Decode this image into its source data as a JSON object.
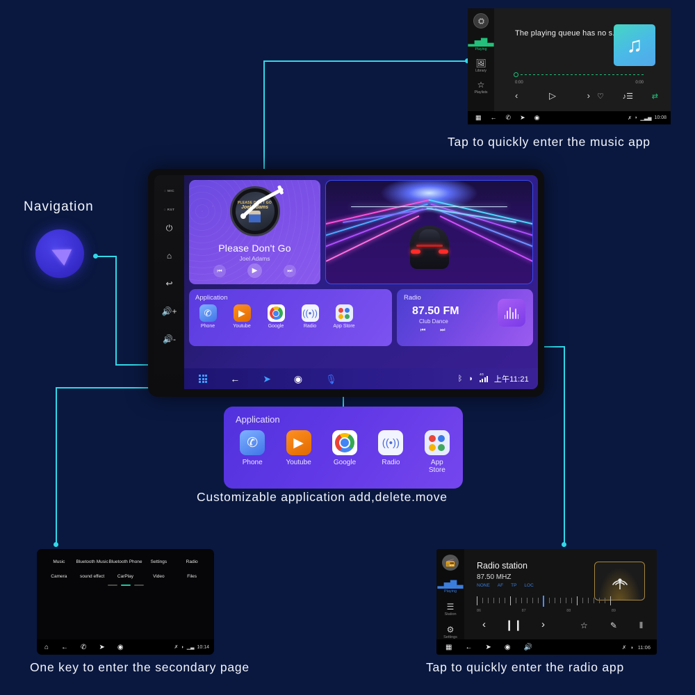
{
  "page": {
    "background_color": "#0a1840",
    "accent_line_color": "#31d9e8"
  },
  "navigation_badge": {
    "label": "Navigation",
    "icon": "navigation-arrow-icon"
  },
  "captions": {
    "music": "Tap to quickly enter the music app",
    "application": "Customizable application add,delete.move",
    "secondary": "One key to enter the secondary page",
    "radio": "Tap to quickly enter the radio app"
  },
  "music_app": {
    "sidebar": {
      "chip_icon": "app-chip-icon",
      "items": [
        {
          "label": "Playing",
          "icon": "equalizer-icon",
          "active": true
        },
        {
          "label": "Library",
          "icon": "library-image-icon",
          "active": false
        },
        {
          "label": "Playlists",
          "icon": "star-icon",
          "active": false
        }
      ]
    },
    "now_playing_text": "The playing queue has no s...",
    "album_art_icon": "music-note-icon",
    "time_elapsed": "0:00",
    "time_total": "0:00",
    "controls": [
      {
        "name": "previous-button",
        "glyph": "‹"
      },
      {
        "name": "play-button",
        "glyph": "▷"
      },
      {
        "name": "next-button",
        "glyph": "›"
      }
    ],
    "secondary_controls": [
      {
        "name": "favorite-button",
        "glyph": "♡",
        "active": false
      },
      {
        "name": "queue-button",
        "glyph": "♪☰",
        "active": false
      },
      {
        "name": "repeat-button",
        "glyph": "⇄",
        "active": true
      }
    ],
    "taskbar": {
      "left_icons": [
        "apps-grid-icon",
        "back-arrow-icon",
        "phone-icon",
        "navigation-icon",
        "play-circle-icon"
      ],
      "status_icons": [
        "bluetooth-off-icon",
        "wifi-icon",
        "signal-icon"
      ],
      "time": "10:08"
    }
  },
  "head_unit": {
    "side_buttons": [
      {
        "label": "MIC",
        "type": "text"
      },
      {
        "label": "RST",
        "type": "text"
      },
      {
        "label": "power-icon",
        "glyph": "⏻"
      },
      {
        "label": "home-icon",
        "glyph": "⌂"
      },
      {
        "label": "back-icon",
        "glyph": "↩"
      },
      {
        "label": "volume-up-icon",
        "glyph": "◁+"
      },
      {
        "label": "volume-down-icon",
        "glyph": "◁-"
      }
    ],
    "music_card": {
      "title": "Please Don't Go",
      "artist": "Joel Adams",
      "cover_line1": "PLEASE DON'T GO",
      "cover_line2": "Joel Adams",
      "controls": [
        {
          "name": "previous-track-button",
          "glyph": "⏮"
        },
        {
          "name": "play-button",
          "glyph": "▶"
        },
        {
          "name": "next-track-button",
          "glyph": "⏭"
        }
      ]
    },
    "video_card": {
      "name": "neon-road-car-wallpaper"
    },
    "application_card": {
      "title": "Application",
      "apps": [
        {
          "label": "Phone",
          "icon": "phone-icon"
        },
        {
          "label": "Youtube",
          "icon": "youtube-icon"
        },
        {
          "label": "Google",
          "icon": "chrome-icon"
        },
        {
          "label": "Radio",
          "icon": "radio-icon"
        },
        {
          "label": "App Store",
          "icon": "app-store-icon"
        }
      ]
    },
    "radio_card": {
      "title": "Radio",
      "frequency": "87.50 FM",
      "station_name": "Club Dance",
      "controls": [
        {
          "name": "previous-station-button",
          "glyph": "⏮"
        },
        {
          "name": "next-station-button",
          "glyph": "⏭"
        }
      ],
      "tile_icon": "equalizer-icon"
    },
    "taskbar": {
      "items": [
        {
          "name": "apps-grid-icon",
          "glyph": ""
        },
        {
          "name": "back-arrow-icon",
          "glyph": "←"
        },
        {
          "name": "navigation-icon",
          "glyph": "➤"
        },
        {
          "name": "play-circle-icon",
          "glyph": "▶"
        },
        {
          "name": "microphone-icon",
          "glyph": "Ἲ4"
        }
      ],
      "status": {
        "bluetooth": "bluetooth-icon",
        "wifi": "wifi-icon",
        "signal": "4G",
        "time": "上午11:21"
      }
    }
  },
  "application_popup": {
    "title": "Application",
    "apps": [
      {
        "label": "Phone",
        "icon": "phone-icon"
      },
      {
        "label": "Youtube",
        "icon": "youtube-icon"
      },
      {
        "label": "Google",
        "icon": "chrome-icon"
      },
      {
        "label": "Radio",
        "icon": "radio-icon"
      },
      {
        "label": "App Store",
        "icon": "app-store-icon"
      }
    ]
  },
  "secondary_page": {
    "apps": [
      {
        "label": "Music",
        "icon": "music-icon",
        "c1": "#63d8c4",
        "c2": "#f2d35a"
      },
      {
        "label": "Bluetooth Music",
        "icon": "bluetooth-music-icon",
        "c1": "#d946a8",
        "c2": "#5ee06a"
      },
      {
        "label": "Bluetooth Phone",
        "icon": "bluetooth-phone-icon",
        "c1": "#3fc98e",
        "c2": "#f0553f"
      },
      {
        "label": "Settings",
        "icon": "settings-icon",
        "c1": "#3aa0e8",
        "c2": "#f0d93f"
      },
      {
        "label": "Radio",
        "icon": "radio-icon",
        "c1": "#4fd6a8",
        "c2": "#4fd6a8"
      },
      {
        "label": "Camera",
        "icon": "camera-icon",
        "c1": "#d94fa8",
        "c2": "#f0a93f"
      },
      {
        "label": "sound effect",
        "icon": "sound-effect-icon",
        "c1": "#e8407f",
        "c2": "#b0e83f"
      },
      {
        "label": "CarPlay",
        "icon": "carplay-icon",
        "c1": "#2fd67a",
        "c2": "#1f9e5a"
      },
      {
        "label": "Video",
        "icon": "video-icon",
        "c1": "#4fb0e8",
        "c2": "#9ce04f"
      },
      {
        "label": "Files",
        "icon": "files-icon",
        "c1": "#d9c83f",
        "c2": "#8fd93f"
      }
    ],
    "page_dots": {
      "count": 3,
      "active_index": 1
    },
    "taskbar": {
      "left_icons": [
        "home-icon",
        "back-arrow-icon",
        "phone-icon",
        "navigation-icon",
        "play-circle-icon"
      ],
      "status_icons": [
        "bluetooth-off-icon",
        "wifi-icon",
        "signal-icon"
      ],
      "time": "10:14"
    }
  },
  "radio_app": {
    "sidebar": {
      "chip_icon": "radio-device-icon",
      "items": [
        {
          "label": "Playing",
          "icon": "equalizer-icon",
          "active": true
        },
        {
          "label": "Station",
          "icon": "list-icon",
          "active": false
        },
        {
          "label": "Settings",
          "icon": "gear-icon",
          "active": false
        }
      ]
    },
    "title": "Radio station",
    "frequency": "87.50 MHZ",
    "tags": [
      "NONE",
      "AF",
      "TP",
      "LOC"
    ],
    "dial_labels": [
      "86",
      "87",
      "88",
      "89"
    ],
    "tile_icon": "radio-tower-icon",
    "controls": [
      {
        "name": "previous-button",
        "glyph": "‹"
      },
      {
        "name": "pause-button",
        "glyph": "❙❙"
      },
      {
        "name": "next-button",
        "glyph": "›"
      }
    ],
    "secondary_controls": [
      {
        "name": "favorite-button",
        "glyph": "☆"
      },
      {
        "name": "edit-button",
        "glyph": "✎"
      },
      {
        "name": "equalizer-button",
        "glyph": "⫴"
      }
    ],
    "taskbar": {
      "left_icons": [
        "apps-grid-icon",
        "back-arrow-icon",
        "navigation-icon",
        "play-circle-icon",
        "volume-icon"
      ],
      "status_icons": [
        "bluetooth-off-icon",
        "wifi-icon"
      ],
      "time": "11:06"
    }
  }
}
